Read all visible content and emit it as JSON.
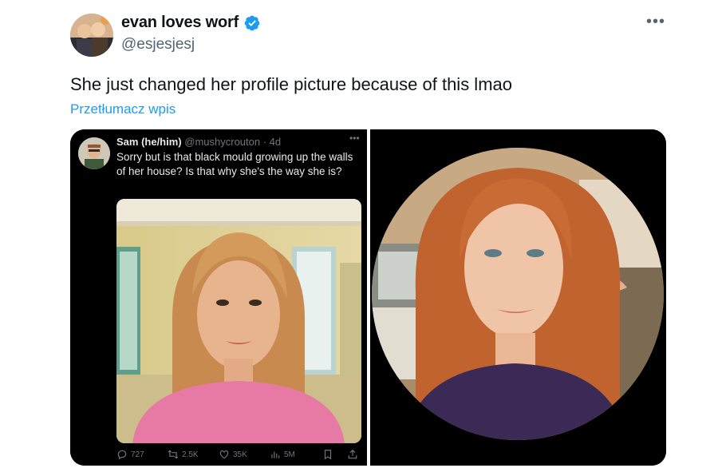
{
  "tweet": {
    "author_name": "evan loves worf",
    "handle": "@esjesjesj",
    "more_icon": "more-horizontal-icon",
    "verified_icon": "verified-badge-icon",
    "text": "She just changed her profile picture because of this lmao",
    "translate_label": "Przetłumacz wpis"
  },
  "quoted_tweet": {
    "name": "Sam (he/him)",
    "handle_time": "@mushycrouton · 4d",
    "text": "Sorry but is that black mould growing up the walls of her house? Is that why she's the way she is?",
    "actions": {
      "replies": "727",
      "reposts": "2.5K",
      "likes": "35K",
      "views": "5M"
    }
  },
  "colors": {
    "accent": "#1d9bf0",
    "text": "#0f1419",
    "secondary": "#536471",
    "media_bg": "#000000"
  }
}
